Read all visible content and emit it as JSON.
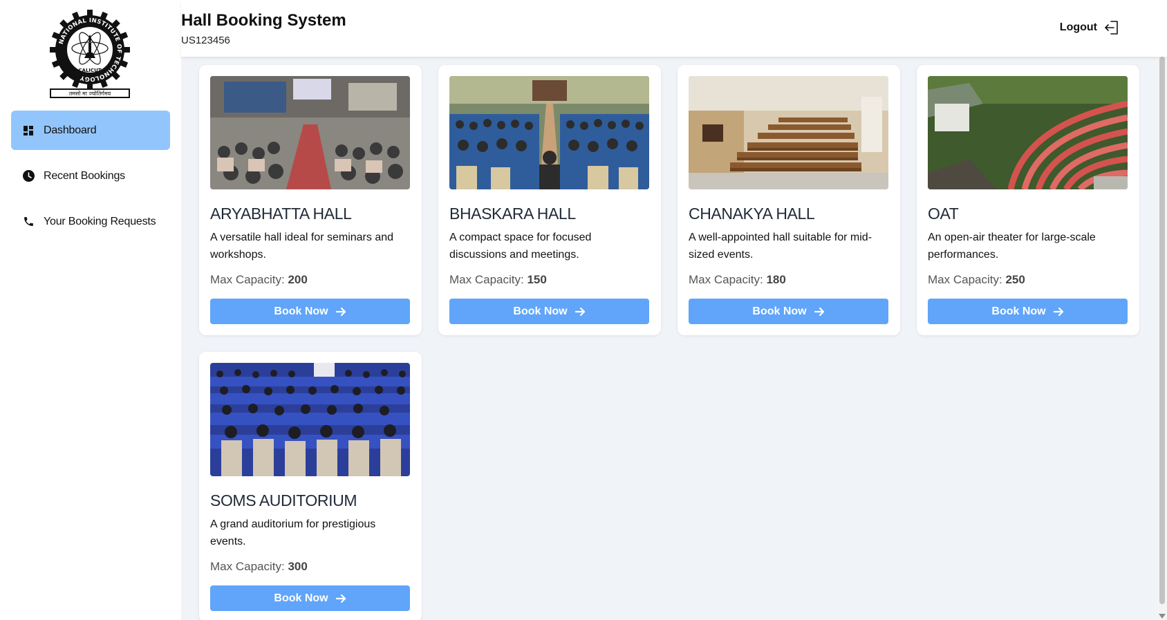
{
  "header": {
    "title": "Hall Booking System",
    "user_id": "US123456",
    "logout_label": "Logout",
    "logout_icon": "logout-icon"
  },
  "logo": {
    "ring_text": "NATIONAL INSTITUTE OF TECHNOLOGY",
    "bottom_text": "CALICUT",
    "motto": "तमसो मा ज्योतिर्गमय"
  },
  "sidebar": {
    "items": [
      {
        "label": "Dashboard",
        "icon": "dashboard-icon",
        "active": true
      },
      {
        "label": "Recent Bookings",
        "icon": "clock-icon",
        "active": false
      },
      {
        "label": "Your Booking Requests",
        "icon": "phone-icon",
        "active": false
      }
    ]
  },
  "halls": [
    {
      "name": "ARYABHATTA HALL",
      "description": "A versatile hall ideal for seminars and workshops.",
      "capacity_label": "Max Capacity:",
      "capacity": "200",
      "button": "Book Now"
    },
    {
      "name": "BHASKARA HALL",
      "description": "A compact space for focused discussions and meetings.",
      "capacity_label": "Max Capacity:",
      "capacity": "150",
      "button": "Book Now"
    },
    {
      "name": "CHANAKYA HALL",
      "description": "A well-appointed hall suitable for mid-sized events.",
      "capacity_label": "Max Capacity:",
      "capacity": "180",
      "button": "Book Now"
    },
    {
      "name": "OAT",
      "description": "An open-air theater for large-scale performances.",
      "capacity_label": "Max Capacity:",
      "capacity": "250",
      "button": "Book Now"
    },
    {
      "name": "SOMS AUDITORIUM",
      "description": "A grand auditorium for prestigious events.",
      "capacity_label": "Max Capacity:",
      "capacity": "300",
      "button": "Book Now"
    }
  ],
  "colors": {
    "accent": "#60a5fa",
    "nav_active": "#93c5fd",
    "main_bg": "#f0f3f8"
  }
}
